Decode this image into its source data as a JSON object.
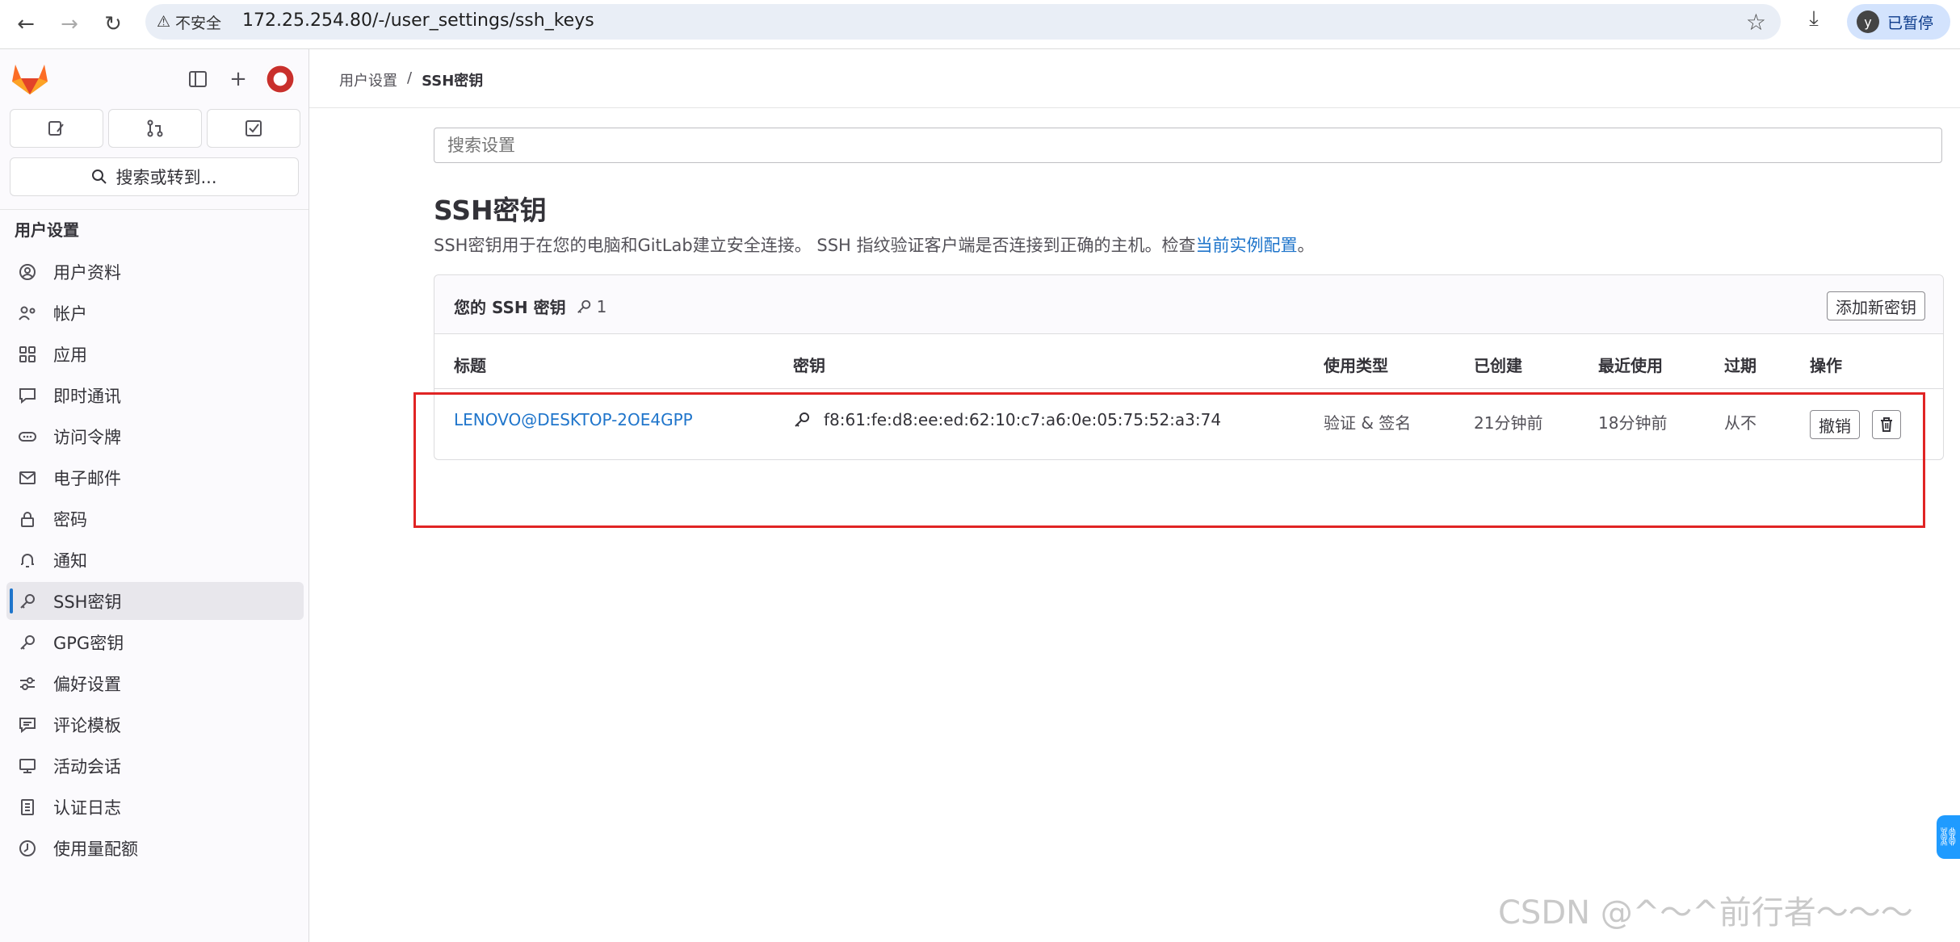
{
  "browser": {
    "security_label": "不安全",
    "url": "172.25.254.80/-/user_settings/ssh_keys",
    "profile_initial": "y",
    "profile_status": "已暂停"
  },
  "sidebar": {
    "search_label": "搜索或转到...",
    "heading": "用户设置",
    "items": [
      {
        "label": "用户资料",
        "icon": "profile-icon"
      },
      {
        "label": "帐户",
        "icon": "account-icon"
      },
      {
        "label": "应用",
        "icon": "applications-icon"
      },
      {
        "label": "即时通讯",
        "icon": "chat-icon"
      },
      {
        "label": "访问令牌",
        "icon": "token-icon"
      },
      {
        "label": "电子邮件",
        "icon": "mail-icon"
      },
      {
        "label": "密码",
        "icon": "lock-icon"
      },
      {
        "label": "通知",
        "icon": "bell-icon"
      },
      {
        "label": "SSH密钥",
        "icon": "key-icon",
        "active": true
      },
      {
        "label": "GPG密钥",
        "icon": "key-icon"
      },
      {
        "label": "偏好设置",
        "icon": "preferences-icon"
      },
      {
        "label": "评论模板",
        "icon": "comment-icon"
      },
      {
        "label": "活动会话",
        "icon": "monitor-icon"
      },
      {
        "label": "认证日志",
        "icon": "log-icon"
      },
      {
        "label": "使用量配额",
        "icon": "quota-icon"
      }
    ]
  },
  "breadcrumb": {
    "parent": "用户设置",
    "separator": "/",
    "current": "SSH密钥"
  },
  "search": {
    "placeholder": "搜索设置"
  },
  "page": {
    "title": "SSH密钥",
    "description": "SSH密钥用于在您的电脑和GitLab建立安全连接。 SSH 指纹验证客户端是否连接到正确的主机。检查",
    "description_link": "当前实例配置",
    "description_end": "。"
  },
  "keys_card": {
    "title": "您的 SSH 密钥",
    "count": "1",
    "add_button": "添加新密钥",
    "columns": {
      "title": "标题",
      "key": "密钥",
      "usage": "使用类型",
      "created": "已创建",
      "last_used": "最近使用",
      "expires": "过期",
      "actions": "操作"
    },
    "rows": [
      {
        "title": "LENOVO@DESKTOP-2OE4GPP",
        "fingerprint": "f8:61:fe:d8:ee:ed:62:10:c7:a6:0e:05:75:52:a3:74",
        "usage": "验证 & 签名",
        "created": "21分钟前",
        "last_used": "18分钟前",
        "expires": "从不",
        "revoke": "撤销"
      }
    ]
  },
  "watermark": "CSDN @^～^前行者～～～",
  "colors": {
    "accent": "#1f75cb",
    "highlight": "#e02424"
  }
}
